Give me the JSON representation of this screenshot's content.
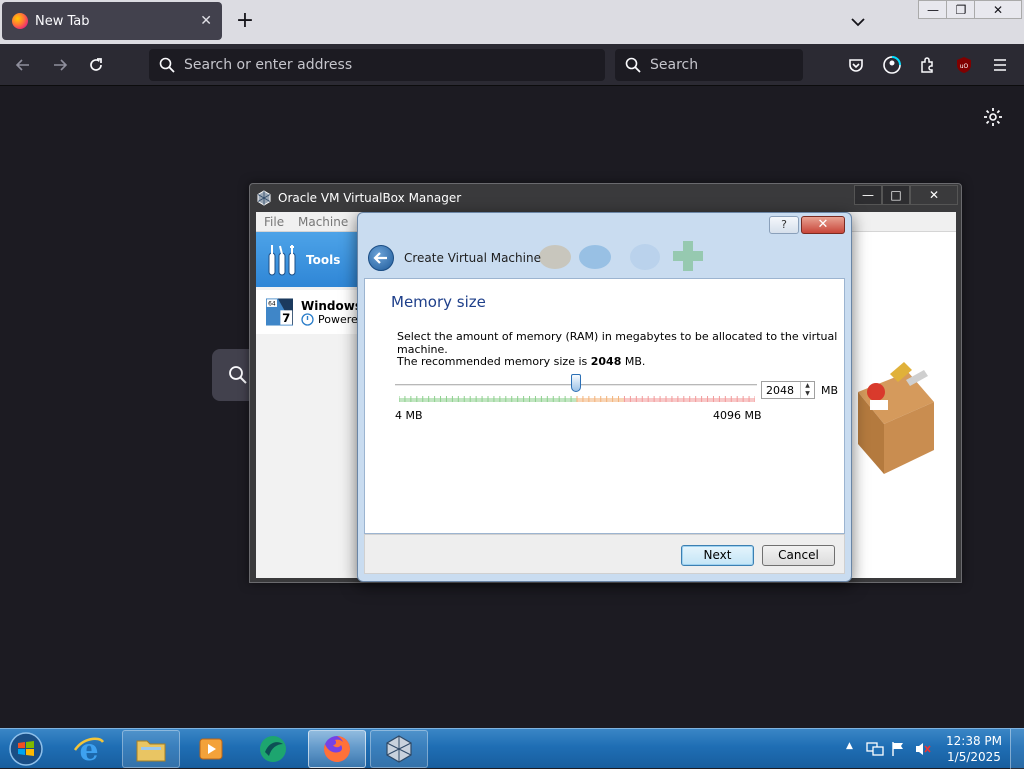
{
  "browser": {
    "tab_title": "New Tab",
    "tab_close": "✕",
    "new_tab": "+",
    "url_placeholder": "Search or enter address",
    "search_placeholder": "Search",
    "window_controls": {
      "minimize": "—",
      "restore": "❐",
      "close": "✕"
    }
  },
  "vbox_manager": {
    "title": "Oracle VM VirtualBox Manager",
    "menu": [
      "File",
      "Machine"
    ],
    "tools_label": "Tools",
    "vm_name": "Windows",
    "vm_state": "Powere",
    "vm_badge_top": "64",
    "vm_badge_num": "7",
    "window_controls": {
      "minimize": "—",
      "maximize": "□",
      "close": "✕"
    }
  },
  "wizard": {
    "help_label": "?",
    "close_label": "✕",
    "title": "Create Virtual Machine",
    "page_title": "Memory size",
    "description": "Select the amount of memory (RAM) in megabytes to be allocated to the virtual machine.",
    "recommended_prefix": "The recommended memory size is ",
    "recommended_value": "2048",
    "recommended_suffix": " MB.",
    "memory_value": "2048",
    "memory_unit": "MB",
    "slider_min_label": "4 MB",
    "slider_max_label": "4096 MB",
    "slider_fraction": 0.5,
    "next_label": "Next",
    "cancel_label": "Cancel"
  },
  "taskbar": {
    "items": [
      "start-orb",
      "internet-explorer",
      "file-explorer",
      "media-player",
      "app-teal",
      "firefox",
      "virtualbox"
    ],
    "clock_time": "12:38 PM",
    "clock_date": "1/5/2025"
  },
  "colors": {
    "firefox_bg": "#1c1b22",
    "wizard_heading": "#1e3f8a",
    "taskbar": "#1f6eb4"
  }
}
